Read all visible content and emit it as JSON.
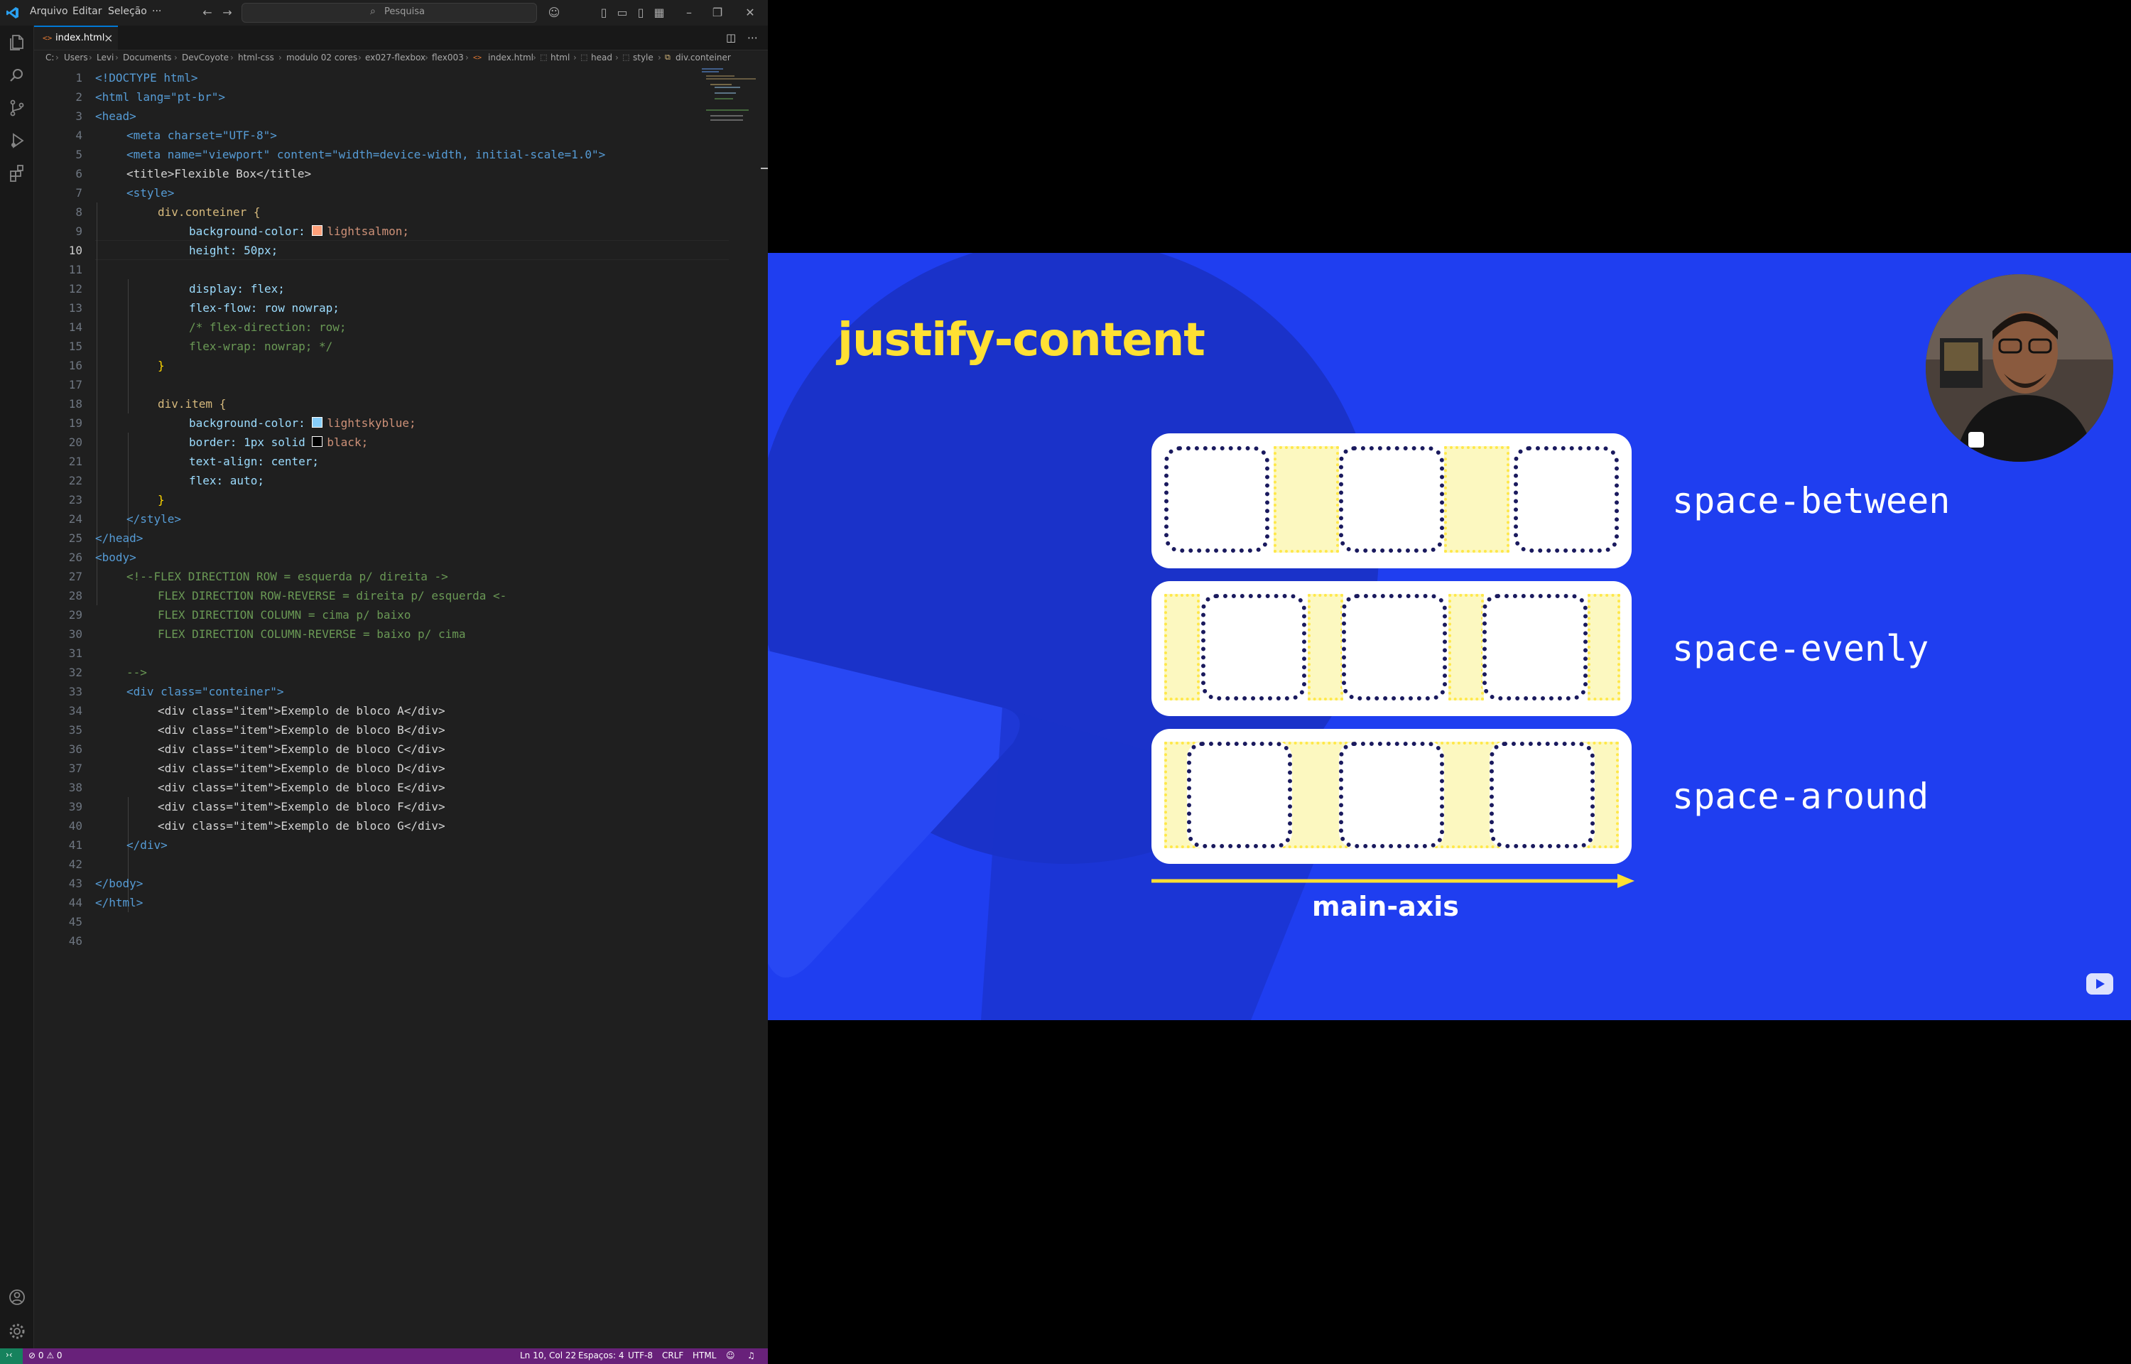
{
  "titlebar": {
    "menu": [
      "Arquivo",
      "Editar",
      "Seleção",
      "···"
    ],
    "search_placeholder": "Pesquisa"
  },
  "tabs": [
    {
      "label": "index.html",
      "icon": "html-file-icon"
    }
  ],
  "breadcrumb": [
    "C:",
    "Users",
    "Levi",
    "Documents",
    "DevCoyote",
    "html-css",
    "modulo 02 cores",
    "ex027-flexbox",
    "flex003",
    "index.html",
    "html",
    "head",
    "style",
    "div.conteiner"
  ],
  "editor": {
    "active_line": 10,
    "line_numbers": [
      "1",
      "2",
      "3",
      "4",
      "5",
      "6",
      "7",
      "8",
      "9",
      "10",
      "11",
      "12",
      "13",
      "14",
      "15",
      "16",
      "17",
      "18",
      "19",
      "20",
      "21",
      "22",
      "23",
      "24",
      "25",
      "26",
      "27",
      "28",
      "29",
      "30",
      "31",
      "32",
      "33",
      "34",
      "35",
      "36",
      "37",
      "38",
      "39",
      "40",
      "41",
      "42",
      "43",
      "44",
      "45",
      "46"
    ],
    "code": {
      "l1": "<!DOCTYPE html>",
      "l2": "<html lang=\"pt-br\">",
      "l3": "<head>",
      "l4": "<meta charset=\"UTF-8\">",
      "l5": "<meta name=\"viewport\" content=\"width=device-width, initial-scale=1.0\">",
      "l6": "<title>Flexible Box</title>",
      "l7": "<style>",
      "l8": "div.conteiner {",
      "l9_prop": "background-color:",
      "l9_val": "lightsalmon;",
      "l10": "height: 50px;",
      "l12": "display: flex;",
      "l13": "flex-flow: row nowrap;",
      "l14": "/* flex-direction: row;",
      "l15": "flex-wrap: nowrap; */",
      "l16": "}",
      "l18": "div.item {",
      "l19_prop": "background-color:",
      "l19_val": "lightskyblue;",
      "l20_prop": "border: 1px solid",
      "l20_val": "black;",
      "l21": "text-align: center;",
      "l22": "flex: auto;",
      "l23": "}",
      "l24": "</style>",
      "l25": "</head>",
      "l26": "<body>",
      "l27": "<!--FLEX DIRECTION ROW = esquerda p/ direita ->",
      "l28": "FLEX DIRECTION ROW-REVERSE = direita p/ esquerda <-",
      "l29": "FLEX DIRECTION COLUMN = cima p/ baixo",
      "l30": "FLEX DIRECTION COLUMN-REVERSE = baixo p/ cima",
      "l32": "-->",
      "l33": "<div class=\"conteiner\">",
      "items": [
        "<div class=\"item\">Exemplo de bloco A</div>",
        "<div class=\"item\">Exemplo de bloco B</div>",
        "<div class=\"item\">Exemplo de bloco C</div>",
        "<div class=\"item\">Exemplo de bloco D</div>",
        "<div class=\"item\">Exemplo de bloco E</div>",
        "<div class=\"item\">Exemplo de bloco F</div>",
        "<div class=\"item\">Exemplo de bloco G</div>"
      ],
      "l41": "</div>",
      "l43": "</body>",
      "l44": "</html>"
    },
    "colors": {
      "lightsalmon": "#ffa07a",
      "lightskyblue": "#87cefa",
      "black": "#000000"
    }
  },
  "statusbar": {
    "problems": "⊘ 0 ⚠ 0",
    "position": "Ln 10, Col 22",
    "spaces": "Espaços: 4",
    "encoding": "UTF-8",
    "eol": "CRLF",
    "language": "HTML",
    "color": "#68217a"
  },
  "slide": {
    "title": "justify-content",
    "rows": [
      {
        "label": "space-between"
      },
      {
        "label": "space-evenly"
      },
      {
        "label": "space-around"
      }
    ],
    "axis_label": "main-axis",
    "background": "#1f3ef0",
    "accent": "#ffe033"
  }
}
